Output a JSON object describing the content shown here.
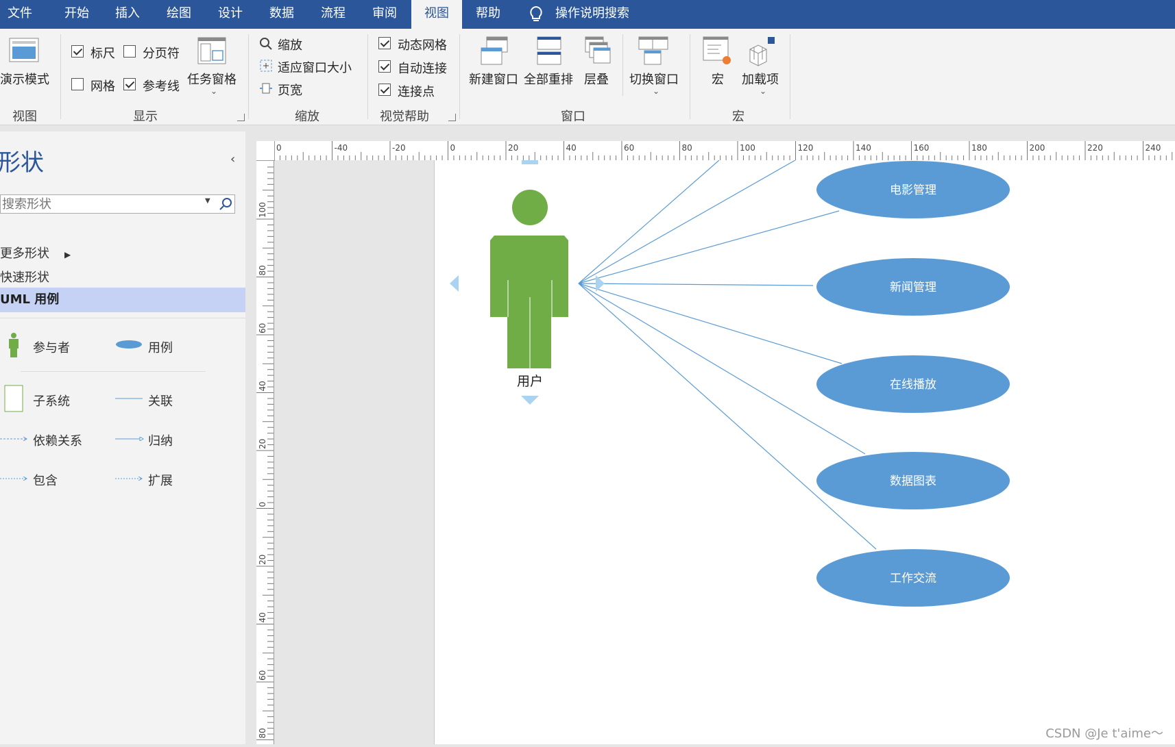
{
  "tabs": [
    "文件",
    "开始",
    "插入",
    "绘图",
    "设计",
    "数据",
    "流程",
    "审阅",
    "视图",
    "帮助"
  ],
  "active_tab": "视图",
  "tell_me": "操作说明搜索",
  "ribbon": {
    "view_group": {
      "presentation_mode": "演示模式",
      "label": "视图"
    },
    "show_group": {
      "ruler": "标尺",
      "ruler_checked": true,
      "page_breaks": "分页符",
      "page_breaks_checked": false,
      "grid": "网格",
      "grid_checked": false,
      "guides": "参考线",
      "guides_checked": true,
      "task_panes": "任务窗格",
      "label": "显示"
    },
    "zoom_group": {
      "zoom": "缩放",
      "fit_to_window": "适应窗口大小",
      "page_width": "页宽",
      "label": "缩放"
    },
    "visual_aids_group": {
      "dynamic_grid": "动态网格",
      "dynamic_grid_checked": true,
      "autoconnect": "自动连接",
      "autoconnect_checked": true,
      "connection_points": "连接点",
      "connection_points_checked": true,
      "label": "视觉帮助"
    },
    "window_group": {
      "new_window": "新建窗口",
      "arrange_all": "全部重排",
      "cascade": "层叠",
      "switch_windows": "切换窗口",
      "label": "窗口"
    },
    "macros_group": {
      "macros": "宏",
      "add_ins": "加载项",
      "label": "宏"
    }
  },
  "shapes_pane": {
    "title": "形状",
    "search_placeholder": "搜索形状",
    "items": {
      "more_shapes": "更多形状",
      "quick_shapes": "快速形状",
      "uml_use_case": "UML 用例"
    },
    "stencils": {
      "actor": "参与者",
      "use_case": "用例",
      "subsystem": "子系统",
      "association": "关联",
      "dependency": "依赖关系",
      "generalization": "归纳",
      "include": "包含",
      "extend": "扩展"
    }
  },
  "ruler": {
    "h_labels": [
      "0",
      "-40",
      "-20",
      "0",
      "20",
      "40",
      "60",
      "80",
      "100",
      "120",
      "140",
      "160",
      "180",
      "200",
      "220",
      "240"
    ],
    "v_labels": [
      "100",
      "80",
      "60",
      "40",
      "20",
      "0",
      "20",
      "40",
      "60",
      "80"
    ]
  },
  "diagram": {
    "actor_label": "用户",
    "use_cases": [
      "电影管理",
      "新闻管理",
      "在线播放",
      "数据图表",
      "工作交流"
    ]
  },
  "colors": {
    "ribbon_blue": "#2b579a",
    "actor_green": "#70ad47",
    "usecase_blue": "#5b9bd5",
    "connector": "#5b9bd5"
  },
  "watermark": "CSDN @Je t'aime～"
}
